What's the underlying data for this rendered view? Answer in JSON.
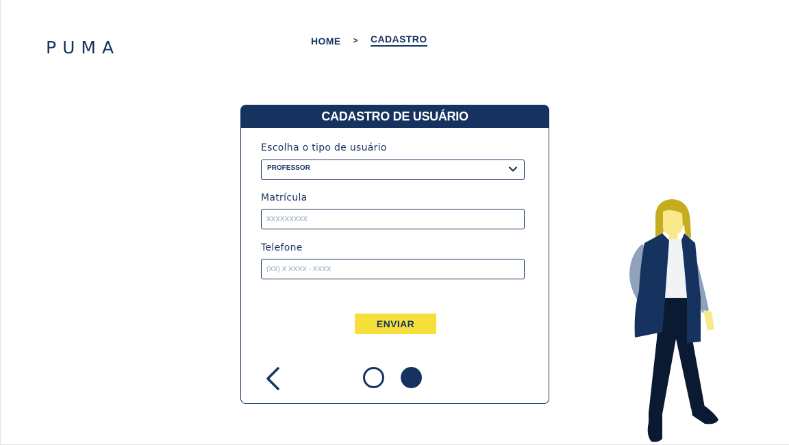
{
  "brand": {
    "logo": "PUMA"
  },
  "breadcrumb": {
    "home": "HOME",
    "separator": ">",
    "current": "CADASTRO"
  },
  "card": {
    "title": "CADASTRO DE USUÁRIO",
    "user_type": {
      "label": "Escolha o tipo de usuário",
      "selected": "PROFESSOR"
    },
    "matricula": {
      "label": "Matrícula",
      "placeholder": "XXXXXXXXX",
      "value": ""
    },
    "telefone": {
      "label": "Telefone",
      "placeholder": "(XX) X XXXX - XXXX",
      "value": ""
    },
    "submit_label": "ENVIAR",
    "pagination": {
      "total_steps": 2,
      "current_step": 2
    }
  },
  "colors": {
    "primary": "#16335f",
    "accent": "#f6df3b",
    "background": "#ffffff"
  },
  "icons": {
    "select": "chevron-down-icon",
    "back": "chevron-left-icon"
  }
}
